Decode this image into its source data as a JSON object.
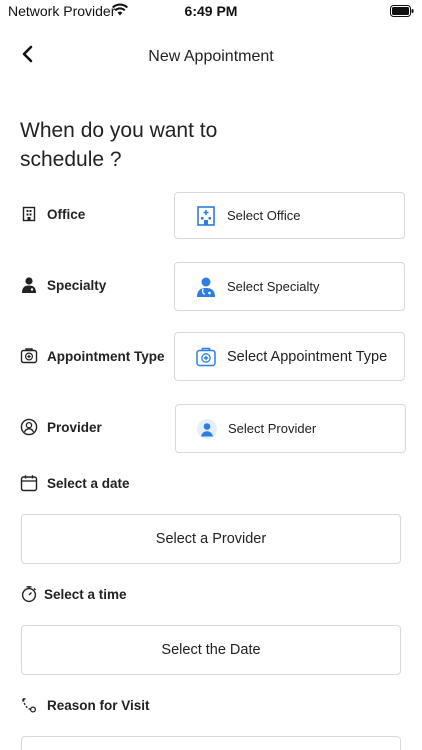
{
  "status_bar": {
    "carrier": "Network Provider",
    "time": "6:49 PM"
  },
  "nav": {
    "title": "New Appointment"
  },
  "heading": "When do you want to schedule ?",
  "fields": {
    "office": {
      "label": "Office",
      "value": "Select Office",
      "icon": "building-icon"
    },
    "specialty": {
      "label": "Specialty",
      "value": "Select Specialty",
      "icon": "doctor-icon"
    },
    "appointment_type": {
      "label": "Appointment Type",
      "value": "Select Appointment Type",
      "icon": "medical-bag-icon"
    },
    "provider": {
      "label": "Provider",
      "value": "Select Provider",
      "icon": "user-avatar-icon"
    }
  },
  "date_section": {
    "label": "Select a date",
    "button": "Select a Provider"
  },
  "time_section": {
    "label": "Select a time",
    "button": "Select the Date"
  },
  "reason_section": {
    "label": "Reason for Visit"
  },
  "colors": {
    "accent_blue": "#2f7de1",
    "border": "#d8d8d8",
    "text": "#222222"
  }
}
